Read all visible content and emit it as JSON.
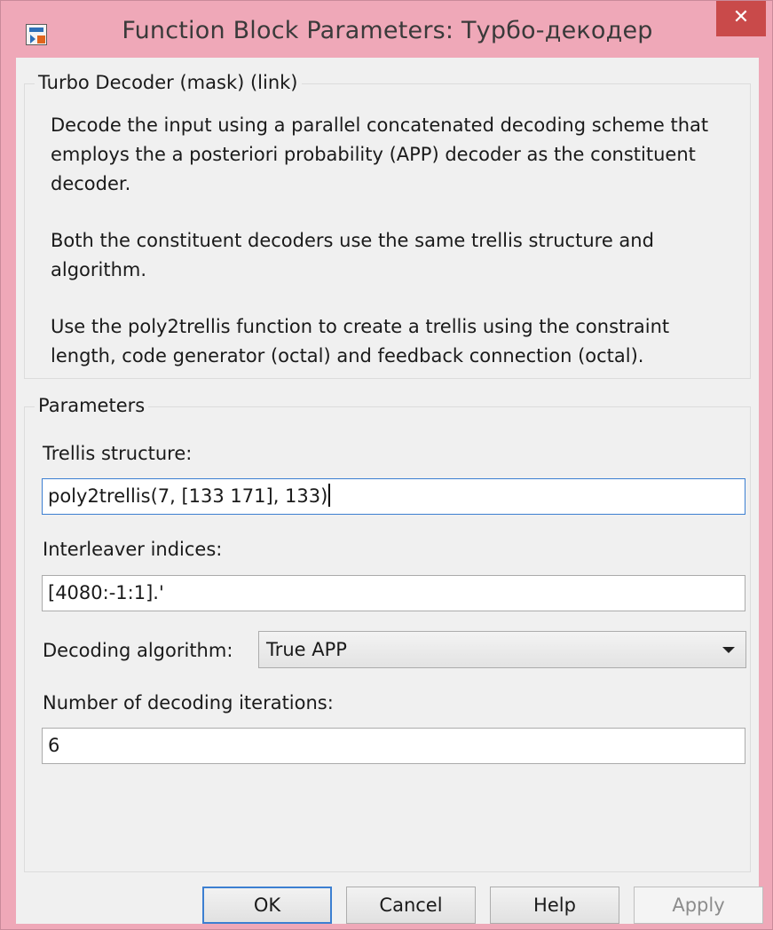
{
  "window": {
    "title": "Function Block Parameters: Турбо-декодер",
    "close_glyph": "✕",
    "icon": "simulink-block-icon"
  },
  "mask_group": {
    "legend": "Turbo Decoder (mask) (link)",
    "paragraphs": [
      [
        "Decode the input using a parallel concatenated decoding scheme that",
        "employs the a posteriori probability (APP) decoder as the constituent",
        "decoder."
      ],
      [
        "Both the constituent decoders use the same trellis structure and",
        "algorithm."
      ],
      [
        "Use the poly2trellis function to create a trellis using the constraint",
        "length, code generator (octal) and feedback connection (octal)."
      ]
    ]
  },
  "parameters": {
    "legend": "Parameters",
    "trellis_label": "Trellis structure:",
    "trellis_value": "poly2trellis(7, [133 171], 133)",
    "interleaver_label": "Interleaver indices:",
    "interleaver_value": "[4080:-1:1].'",
    "algorithm_label": "Decoding algorithm:",
    "algorithm_value": "True APP",
    "iterations_label": "Number of decoding iterations:",
    "iterations_value": "6"
  },
  "buttons": {
    "ok": "OK",
    "cancel": "Cancel",
    "help": "Help",
    "apply": "Apply"
  },
  "colors": {
    "title_bar": "#efa8b8",
    "close_button": "#c94a4a",
    "focus_border": "#3c7fd1"
  }
}
